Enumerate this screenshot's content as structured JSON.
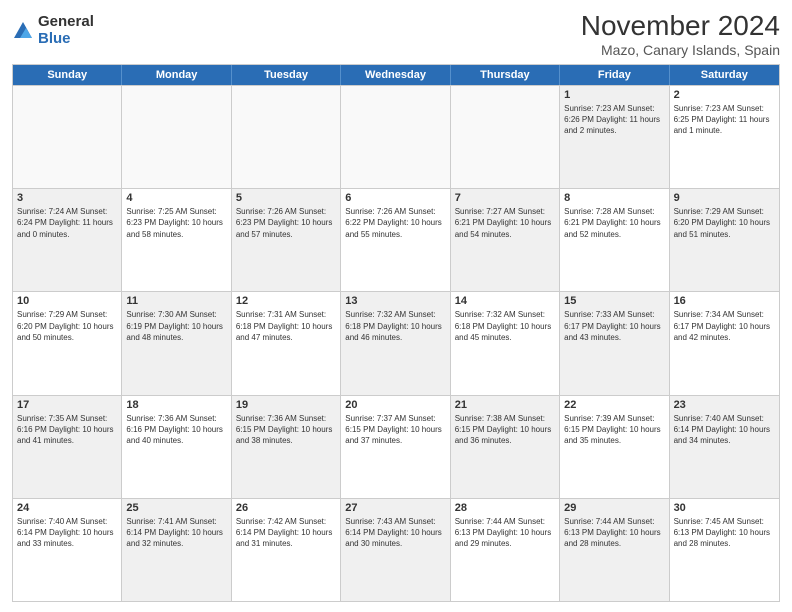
{
  "logo": {
    "general": "General",
    "blue": "Blue"
  },
  "title": "November 2024",
  "subtitle": "Mazo, Canary Islands, Spain",
  "header_days": [
    "Sunday",
    "Monday",
    "Tuesday",
    "Wednesday",
    "Thursday",
    "Friday",
    "Saturday"
  ],
  "rows": [
    [
      {
        "day": "",
        "info": "",
        "empty": true
      },
      {
        "day": "",
        "info": "",
        "empty": true
      },
      {
        "day": "",
        "info": "",
        "empty": true
      },
      {
        "day": "",
        "info": "",
        "empty": true
      },
      {
        "day": "",
        "info": "",
        "empty": true
      },
      {
        "day": "1",
        "info": "Sunrise: 7:23 AM\nSunset: 6:26 PM\nDaylight: 11 hours and 2 minutes.",
        "empty": false,
        "shaded": true
      },
      {
        "day": "2",
        "info": "Sunrise: 7:23 AM\nSunset: 6:25 PM\nDaylight: 11 hours and 1 minute.",
        "empty": false,
        "shaded": false
      }
    ],
    [
      {
        "day": "3",
        "info": "Sunrise: 7:24 AM\nSunset: 6:24 PM\nDaylight: 11 hours and 0 minutes.",
        "empty": false,
        "shaded": true
      },
      {
        "day": "4",
        "info": "Sunrise: 7:25 AM\nSunset: 6:23 PM\nDaylight: 10 hours and 58 minutes.",
        "empty": false,
        "shaded": false
      },
      {
        "day": "5",
        "info": "Sunrise: 7:26 AM\nSunset: 6:23 PM\nDaylight: 10 hours and 57 minutes.",
        "empty": false,
        "shaded": true
      },
      {
        "day": "6",
        "info": "Sunrise: 7:26 AM\nSunset: 6:22 PM\nDaylight: 10 hours and 55 minutes.",
        "empty": false,
        "shaded": false
      },
      {
        "day": "7",
        "info": "Sunrise: 7:27 AM\nSunset: 6:21 PM\nDaylight: 10 hours and 54 minutes.",
        "empty": false,
        "shaded": true
      },
      {
        "day": "8",
        "info": "Sunrise: 7:28 AM\nSunset: 6:21 PM\nDaylight: 10 hours and 52 minutes.",
        "empty": false,
        "shaded": false
      },
      {
        "day": "9",
        "info": "Sunrise: 7:29 AM\nSunset: 6:20 PM\nDaylight: 10 hours and 51 minutes.",
        "empty": false,
        "shaded": true
      }
    ],
    [
      {
        "day": "10",
        "info": "Sunrise: 7:29 AM\nSunset: 6:20 PM\nDaylight: 10 hours and 50 minutes.",
        "empty": false,
        "shaded": false
      },
      {
        "day": "11",
        "info": "Sunrise: 7:30 AM\nSunset: 6:19 PM\nDaylight: 10 hours and 48 minutes.",
        "empty": false,
        "shaded": true
      },
      {
        "day": "12",
        "info": "Sunrise: 7:31 AM\nSunset: 6:18 PM\nDaylight: 10 hours and 47 minutes.",
        "empty": false,
        "shaded": false
      },
      {
        "day": "13",
        "info": "Sunrise: 7:32 AM\nSunset: 6:18 PM\nDaylight: 10 hours and 46 minutes.",
        "empty": false,
        "shaded": true
      },
      {
        "day": "14",
        "info": "Sunrise: 7:32 AM\nSunset: 6:18 PM\nDaylight: 10 hours and 45 minutes.",
        "empty": false,
        "shaded": false
      },
      {
        "day": "15",
        "info": "Sunrise: 7:33 AM\nSunset: 6:17 PM\nDaylight: 10 hours and 43 minutes.",
        "empty": false,
        "shaded": true
      },
      {
        "day": "16",
        "info": "Sunrise: 7:34 AM\nSunset: 6:17 PM\nDaylight: 10 hours and 42 minutes.",
        "empty": false,
        "shaded": false
      }
    ],
    [
      {
        "day": "17",
        "info": "Sunrise: 7:35 AM\nSunset: 6:16 PM\nDaylight: 10 hours and 41 minutes.",
        "empty": false,
        "shaded": true
      },
      {
        "day": "18",
        "info": "Sunrise: 7:36 AM\nSunset: 6:16 PM\nDaylight: 10 hours and 40 minutes.",
        "empty": false,
        "shaded": false
      },
      {
        "day": "19",
        "info": "Sunrise: 7:36 AM\nSunset: 6:15 PM\nDaylight: 10 hours and 38 minutes.",
        "empty": false,
        "shaded": true
      },
      {
        "day": "20",
        "info": "Sunrise: 7:37 AM\nSunset: 6:15 PM\nDaylight: 10 hours and 37 minutes.",
        "empty": false,
        "shaded": false
      },
      {
        "day": "21",
        "info": "Sunrise: 7:38 AM\nSunset: 6:15 PM\nDaylight: 10 hours and 36 minutes.",
        "empty": false,
        "shaded": true
      },
      {
        "day": "22",
        "info": "Sunrise: 7:39 AM\nSunset: 6:15 PM\nDaylight: 10 hours and 35 minutes.",
        "empty": false,
        "shaded": false
      },
      {
        "day": "23",
        "info": "Sunrise: 7:40 AM\nSunset: 6:14 PM\nDaylight: 10 hours and 34 minutes.",
        "empty": false,
        "shaded": true
      }
    ],
    [
      {
        "day": "24",
        "info": "Sunrise: 7:40 AM\nSunset: 6:14 PM\nDaylight: 10 hours and 33 minutes.",
        "empty": false,
        "shaded": false
      },
      {
        "day": "25",
        "info": "Sunrise: 7:41 AM\nSunset: 6:14 PM\nDaylight: 10 hours and 32 minutes.",
        "empty": false,
        "shaded": true
      },
      {
        "day": "26",
        "info": "Sunrise: 7:42 AM\nSunset: 6:14 PM\nDaylight: 10 hours and 31 minutes.",
        "empty": false,
        "shaded": false
      },
      {
        "day": "27",
        "info": "Sunrise: 7:43 AM\nSunset: 6:14 PM\nDaylight: 10 hours and 30 minutes.",
        "empty": false,
        "shaded": true
      },
      {
        "day": "28",
        "info": "Sunrise: 7:44 AM\nSunset: 6:13 PM\nDaylight: 10 hours and 29 minutes.",
        "empty": false,
        "shaded": false
      },
      {
        "day": "29",
        "info": "Sunrise: 7:44 AM\nSunset: 6:13 PM\nDaylight: 10 hours and 28 minutes.",
        "empty": false,
        "shaded": true
      },
      {
        "day": "30",
        "info": "Sunrise: 7:45 AM\nSunset: 6:13 PM\nDaylight: 10 hours and 28 minutes.",
        "empty": false,
        "shaded": false
      }
    ]
  ]
}
